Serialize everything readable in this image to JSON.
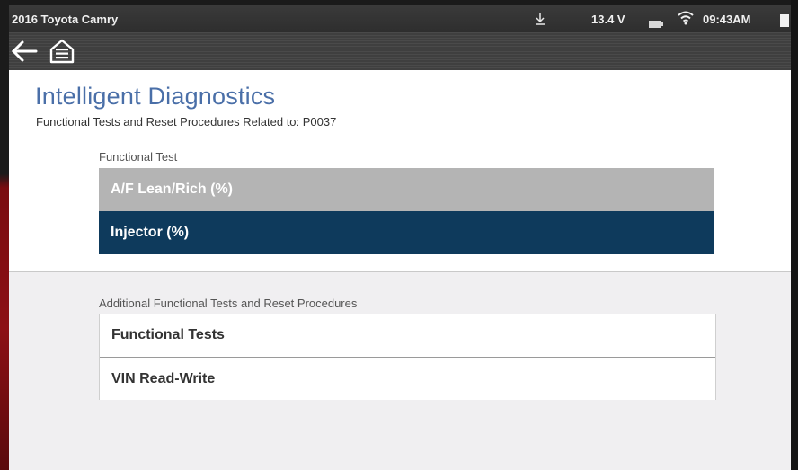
{
  "status_bar": {
    "vehicle": "2016 Toyota Camry",
    "voltage": "13.4 V",
    "time": "09:43AM",
    "icons": [
      "download-icon",
      "battery-icon",
      "wifi-icon",
      "battery-full-icon"
    ]
  },
  "nav": {
    "back_icon": "back-arrow-icon",
    "home_icon": "home-icon"
  },
  "page": {
    "title": "Intelligent Diagnostics",
    "subtitle": "Functional Tests and Reset Procedures Related to:  P0037"
  },
  "functional_test": {
    "label": "Functional Test",
    "items": [
      {
        "label": "A/F Lean/Rich (%)",
        "state": "default"
      },
      {
        "label": "Injector (%)",
        "state": "selected"
      }
    ]
  },
  "additional": {
    "label": "Additional Functional Tests and Reset Procedures",
    "items": [
      {
        "label": "Functional Tests"
      },
      {
        "label": "VIN Read-Write"
      }
    ]
  },
  "colors": {
    "title": "#4a6fa8",
    "selected": "#0e3a5c",
    "unselected": "#b4b4b4",
    "lower_bg": "#f0eff1",
    "frame_red": "#8c1015"
  }
}
